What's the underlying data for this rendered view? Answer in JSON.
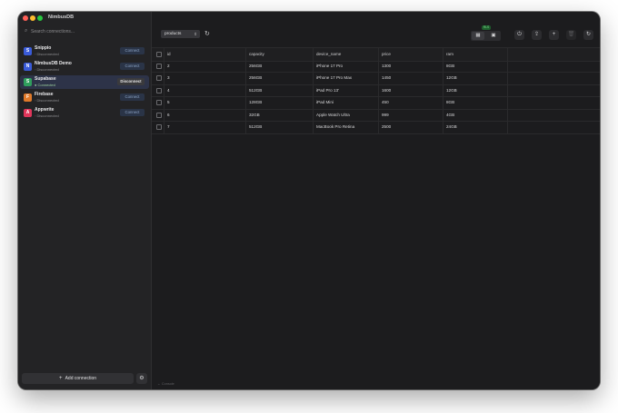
{
  "app": {
    "title": "NimbusDB"
  },
  "sidebar": {
    "search_placeholder": "Search connections...",
    "connections": [
      {
        "name": "Snippio",
        "status": "Disconnected",
        "action": "Connect",
        "icon_color": "#3a5bd9",
        "icon_letter": "S",
        "active": false,
        "connected": false
      },
      {
        "name": "NimbusDB Demo",
        "status": "Disconnected",
        "action": "Connect",
        "icon_color": "#3a5bd9",
        "icon_letter": "N",
        "active": false,
        "connected": false
      },
      {
        "name": "Supabase",
        "status": "Connected",
        "action": "Disconnect",
        "icon_color": "#2f9e5d",
        "icon_letter": "S",
        "active": true,
        "connected": true
      },
      {
        "name": "Firebase",
        "status": "Disconnected",
        "action": "Connect",
        "icon_color": "#e07a2a",
        "icon_letter": "F",
        "active": false,
        "connected": false
      },
      {
        "name": "Appwrite",
        "status": "Disconnected",
        "action": "Connect",
        "icon_color": "#e0365a",
        "icon_letter": "A",
        "active": false,
        "connected": false
      }
    ],
    "add_connection_label": "Add connection"
  },
  "toolbar": {
    "table_name": "products",
    "rls_badge": "RLS"
  },
  "table": {
    "columns": [
      "id",
      "capacity",
      "device_name",
      "price",
      "ram"
    ],
    "rows": [
      [
        "2",
        "256GB",
        "iPhone 17 Pro",
        "1300",
        "8GB"
      ],
      [
        "3",
        "256GB",
        "iPhone 17 Pro Max",
        "1450",
        "12GB"
      ],
      [
        "4",
        "512GB",
        "iPad Pro 13'",
        "1600",
        "12GB"
      ],
      [
        "5",
        "128GB",
        "iPad Mini",
        "450",
        "8GB"
      ],
      [
        "6",
        "32GB",
        "Apple Watch Ultra",
        "999",
        "4GB"
      ],
      [
        "7",
        "512GB",
        "MacBook Pro Retina",
        "2500",
        "24GB"
      ]
    ]
  },
  "statusbar": {
    "text": "← Console"
  }
}
